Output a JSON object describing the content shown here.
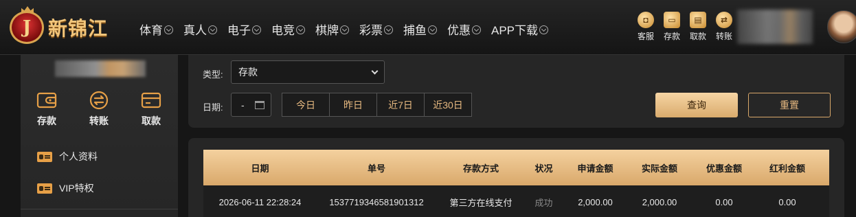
{
  "brand": {
    "name": "新锦江",
    "emblem_letter": "J"
  },
  "nav": {
    "items": [
      {
        "label": "体育"
      },
      {
        "label": "真人"
      },
      {
        "label": "电子"
      },
      {
        "label": "电竞"
      },
      {
        "label": "棋牌"
      },
      {
        "label": "彩票"
      },
      {
        "label": "捕鱼"
      },
      {
        "label": "优惠"
      },
      {
        "label": "APP下载"
      }
    ]
  },
  "quick_actions": [
    {
      "label": "客服",
      "icon": "chat-icon"
    },
    {
      "label": "存款",
      "icon": "wallet-icon"
    },
    {
      "label": "取款",
      "icon": "withdraw-icon"
    },
    {
      "label": "转账",
      "icon": "transfer-icon"
    }
  ],
  "sidebar": {
    "actions": [
      {
        "label": "存款",
        "icon": "wallet-icon"
      },
      {
        "label": "转账",
        "icon": "transfer-icon"
      },
      {
        "label": "取款",
        "icon": "card-icon"
      }
    ],
    "links": [
      {
        "label": "个人资料",
        "icon": "id-card-icon"
      },
      {
        "label": "VIP特权",
        "icon": "id-card-icon"
      }
    ]
  },
  "filter": {
    "type_label": "类型:",
    "type_value": "存款",
    "date_label": "日期:",
    "date_value": "-",
    "quick_dates": [
      "今日",
      "昨日",
      "近7日",
      "近30日"
    ],
    "query_label": "查询",
    "reset_label": "重置"
  },
  "table": {
    "columns": [
      "日期",
      "单号",
      "存款方式",
      "状况",
      "申请金额",
      "实际金额",
      "优惠金额",
      "红利金额"
    ],
    "rows": [
      [
        "2026-06-11 22:28:24",
        "1537719346581901312",
        "第三方在线支付",
        "成功",
        "2,000.00",
        "2,000.00",
        "0.00",
        "0.00"
      ]
    ]
  },
  "colors": {
    "accent": "#d9a86a",
    "accent_light": "#f4d19f",
    "background": "#161616",
    "panel": "#262626"
  }
}
